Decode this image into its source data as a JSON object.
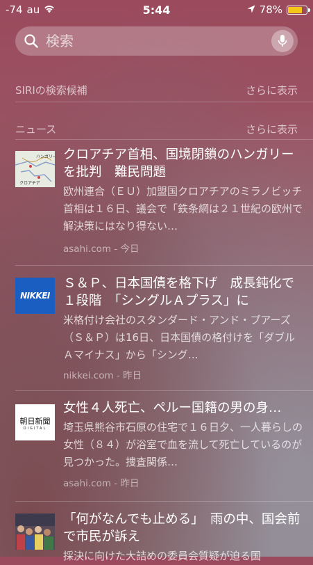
{
  "status_bar": {
    "signal": "-74",
    "carrier": "au",
    "time": "5:44",
    "battery_percent": "78%",
    "battery_level": 0.78,
    "battery_color": "#f5c518"
  },
  "search": {
    "placeholder": "検索",
    "icon": "search-icon",
    "mic_icon": "microphone-icon"
  },
  "siri_section": {
    "title": "SIRIの検索候補",
    "more": "さらに表示"
  },
  "news_section": {
    "title": "ニュース",
    "more": "さらに表示",
    "items": [
      {
        "thumb": "map-thumbnail",
        "thumb_labels": [
          "ハンガリー",
          "クロアチア"
        ],
        "title": "クロアチア首相、国境閉鎖のハンガリーを批判　難民問題",
        "body": "欧州連合（ＥＵ）加盟国クロアチアのミラノビッチ首相は１６日、議会で「鉄条網は２１世紀の欧州で解決策にはなり得ない…",
        "source": "asahi.com - 今日"
      },
      {
        "thumb": "nikkei-logo",
        "thumb_text": "NIKKEI",
        "title": "Ｓ＆Ｐ、日本国債を格下げ　成長鈍化で１段階　「シングルＡプラス」に",
        "body": "米格付け会社のスタンダード・アンド・プアーズ（Ｓ＆Ｐ）は16日、日本国債の格付けを「ダブルＡマイナス」から「シング…",
        "source": "nikkei.com - 昨日"
      },
      {
        "thumb": "asahi-logo",
        "thumb_text": "朝日新聞",
        "thumb_sub": "DIGITAL",
        "title": "女性４人死亡、ペルー国籍の男の身…",
        "body": "埼玉県熊谷市石原の住宅で１６日夕、一人暮らしの女性（８４）が浴室で血を流して死亡しているのが見つかった。捜査関係…",
        "source": "asahi.com - 昨日"
      },
      {
        "thumb": "protest-photo",
        "title": "「何がなんでも止める」　雨の中、国会前で市民が訴え",
        "body": "採決に向けた大詰めの委員会質疑が迫る国"
      }
    ]
  }
}
